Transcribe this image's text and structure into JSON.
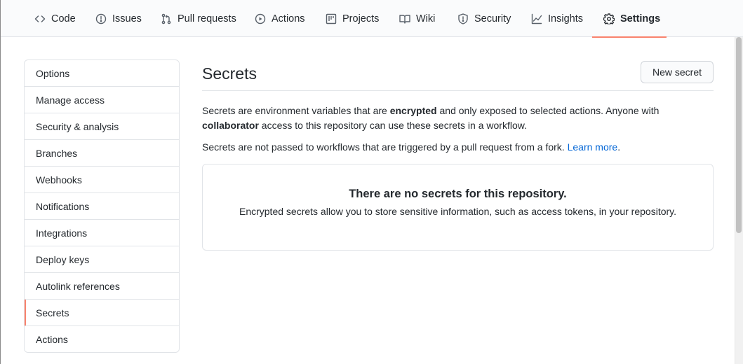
{
  "nav": {
    "tabs": [
      {
        "label": "Code",
        "icon": "code-icon"
      },
      {
        "label": "Issues",
        "icon": "issue-icon"
      },
      {
        "label": "Pull requests",
        "icon": "pull-request-icon"
      },
      {
        "label": "Actions",
        "icon": "play-icon"
      },
      {
        "label": "Projects",
        "icon": "project-icon"
      },
      {
        "label": "Wiki",
        "icon": "book-icon"
      },
      {
        "label": "Security",
        "icon": "shield-icon"
      },
      {
        "label": "Insights",
        "icon": "graph-icon"
      },
      {
        "label": "Settings",
        "icon": "gear-icon"
      }
    ],
    "selected": "Settings"
  },
  "sidebar": {
    "items": [
      {
        "label": "Options"
      },
      {
        "label": "Manage access"
      },
      {
        "label": "Security & analysis"
      },
      {
        "label": "Branches"
      },
      {
        "label": "Webhooks"
      },
      {
        "label": "Notifications"
      },
      {
        "label": "Integrations"
      },
      {
        "label": "Deploy keys"
      },
      {
        "label": "Autolink references"
      },
      {
        "label": "Secrets"
      },
      {
        "label": "Actions"
      }
    ],
    "selected": "Secrets"
  },
  "main": {
    "title": "Secrets",
    "new_secret_label": "New secret",
    "desc_part1": "Secrets are environment variables that are ",
    "desc_bold1": "encrypted",
    "desc_part2": " and only exposed to selected actions. Anyone with ",
    "desc_bold2": "collaborator",
    "desc_part3": " access to this repository can use these secrets in a workflow.",
    "fork_note": "Secrets are not passed to workflows that are triggered by a pull request from a fork. ",
    "learn_more": "Learn more",
    "period": ".",
    "empty_title": "There are no secrets for this repository.",
    "empty_text": "Encrypted secrets allow you to store sensitive information, such as access tokens, in your repository."
  },
  "colors": {
    "accent": "#f9826c",
    "link": "#0366d6",
    "border": "#e1e4e8"
  }
}
